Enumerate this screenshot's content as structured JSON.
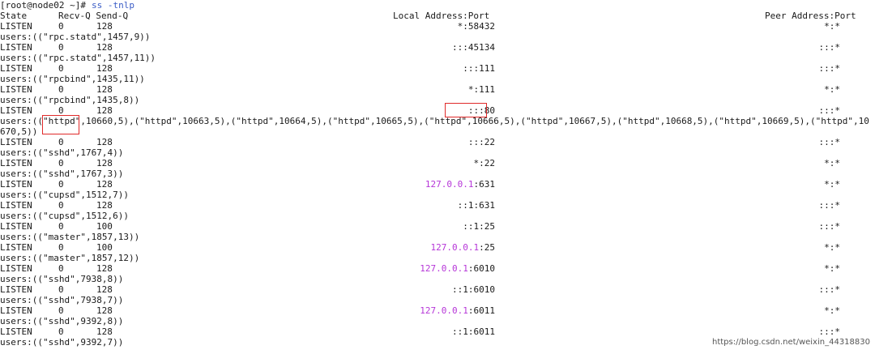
{
  "terminal": {
    "prompt": "[root@node02 ~]# ",
    "command": "ss -tnlp",
    "header": {
      "state": "State",
      "queues": "Recv-Q Send-Q",
      "local": "Local Address:Port",
      "peer": "Peer Address:Port"
    },
    "entries": [
      {
        "state": "LISTEN",
        "recv": "0",
        "send": "128",
        "ip": "",
        "local": "*:58432",
        "peer": "*:*",
        "users": "users:((\"rpc.statd\",1457,9))"
      },
      {
        "state": "LISTEN",
        "recv": "0",
        "send": "128",
        "ip": "",
        "local": ":::45134",
        "peer": ":::*",
        "users": "users:((\"rpc.statd\",1457,11))"
      },
      {
        "state": "LISTEN",
        "recv": "0",
        "send": "128",
        "ip": "",
        "local": ":::111",
        "peer": ":::*",
        "users": "users:((\"rpcbind\",1435,11))"
      },
      {
        "state": "LISTEN",
        "recv": "0",
        "send": "128",
        "ip": "",
        "local": "*:111",
        "peer": "*:*",
        "users": "users:((\"rpcbind\",1435,8))"
      },
      {
        "state": "LISTEN",
        "recv": "0",
        "send": "128",
        "ip": "",
        "local": ":::80",
        "peer": ":::*",
        "users": "users:((\"httpd\",10660,5),(\"httpd\",10663,5),(\"httpd\",10664,5),(\"httpd\",10665,5),(\"httpd\",10666,5),(\"httpd\",10667,5),(\"httpd\",10668,5),(\"httpd\",10669,5),(\"httpd\",10",
        "users_wrap": "670,5))"
      },
      {
        "state": "LISTEN",
        "recv": "0",
        "send": "128",
        "ip": "",
        "local": ":::22",
        "peer": ":::*",
        "users": "users:((\"sshd\",1767,4))"
      },
      {
        "state": "LISTEN",
        "recv": "0",
        "send": "128",
        "ip": "",
        "local": "*:22",
        "peer": "*:*",
        "users": "users:((\"sshd\",1767,3))"
      },
      {
        "state": "LISTEN",
        "recv": "0",
        "send": "128",
        "ip": "127.0.0.1",
        "local": ":631",
        "peer": "*:*",
        "users": "users:((\"cupsd\",1512,7))"
      },
      {
        "state": "LISTEN",
        "recv": "0",
        "send": "128",
        "ip": "",
        "local": "::1:631",
        "peer": ":::*",
        "users": "users:((\"cupsd\",1512,6))"
      },
      {
        "state": "LISTEN",
        "recv": "0",
        "send": "100",
        "ip": "",
        "local": "::1:25",
        "peer": ":::*",
        "users": "users:((\"master\",1857,13))"
      },
      {
        "state": "LISTEN",
        "recv": "0",
        "send": "100",
        "ip": "127.0.0.1",
        "local": ":25",
        "peer": "*:*",
        "users": "users:((\"master\",1857,12))"
      },
      {
        "state": "LISTEN",
        "recv": "0",
        "send": "128",
        "ip": "127.0.0.1",
        "local": ":6010",
        "peer": "*:*",
        "users": "users:((\"sshd\",7938,8))"
      },
      {
        "state": "LISTEN",
        "recv": "0",
        "send": "128",
        "ip": "",
        "local": "::1:6010",
        "peer": ":::*",
        "users": "users:((\"sshd\",7938,7))"
      },
      {
        "state": "LISTEN",
        "recv": "0",
        "send": "128",
        "ip": "127.0.0.1",
        "local": ":6011",
        "peer": "*:*",
        "users": "users:((\"sshd\",9392,8))"
      },
      {
        "state": "LISTEN",
        "recv": "0",
        "send": "128",
        "ip": "",
        "local": "::1:6011",
        "peer": ":::*",
        "users": "users:((\"sshd\",9392,7))"
      }
    ]
  },
  "watermark": "https://blog.csdn.net/weixin_44318830",
  "colors": {
    "text": "#1a1a1a",
    "command": "#3a5cc6",
    "ip_highlight": "#b636d8",
    "annotation_box": "#e02a2a"
  }
}
